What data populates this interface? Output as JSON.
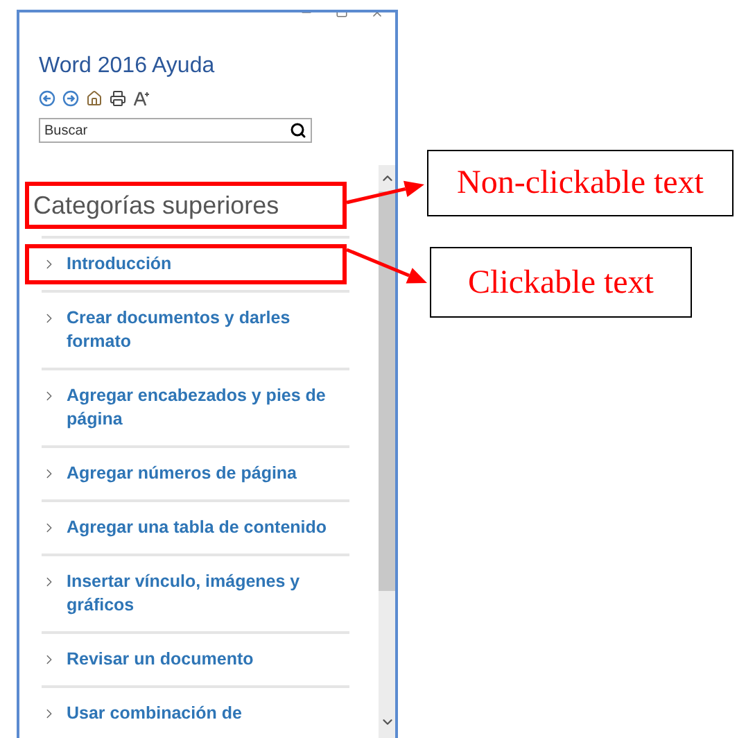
{
  "window": {
    "title": "Word 2016 Ayuda"
  },
  "search": {
    "placeholder": "Buscar"
  },
  "heading": "Categorías superiores",
  "items": [
    {
      "label": "Introducción"
    },
    {
      "label": "Crear documentos y darles formato"
    },
    {
      "label": "Agregar encabezados y pies de página"
    },
    {
      "label": "Agregar números de página"
    },
    {
      "label": "Agregar una tabla de contenido"
    },
    {
      "label": "Insertar vínculo, imágenes y gráficos"
    },
    {
      "label": "Revisar un documento"
    },
    {
      "label": "Usar combinación de"
    }
  ],
  "annotations": [
    {
      "kind": "heading",
      "label": "Non-clickable text"
    },
    {
      "kind": "item",
      "label": "Clickable text"
    }
  ]
}
